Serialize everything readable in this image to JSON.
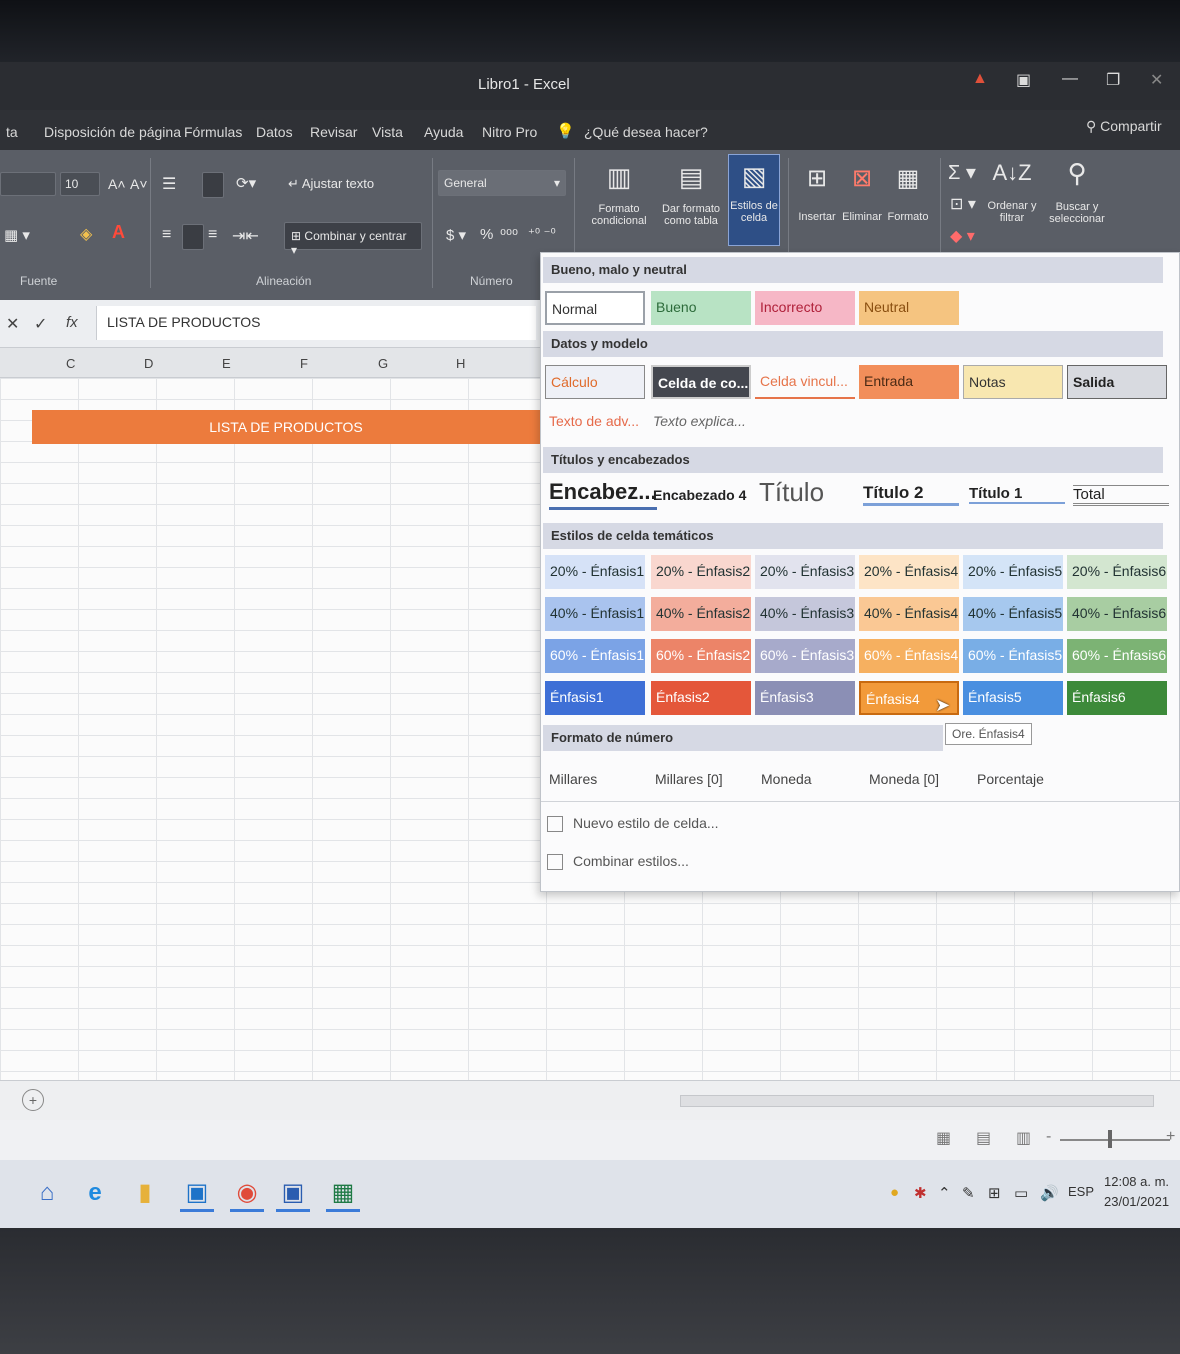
{
  "window": {
    "title": "Libro1 - Excel"
  },
  "tabs": [
    "Disposición de página",
    "Fórmulas",
    "Datos",
    "Revisar",
    "Vista",
    "Ayuda",
    "Nitro Pro"
  ],
  "tell_me": "¿Qué desea hacer?",
  "share": "Compartir",
  "ribbon": {
    "font_size": "10",
    "wrap_text": "Ajustar texto",
    "merge_center": "Combinar y centrar",
    "number_format": "General",
    "currency": "$",
    "percent": "%",
    "conditional_format": "Formato condicional",
    "format_as_table": "Dar formato como tabla",
    "cell_styles": "Estilos de celda",
    "insert": "Insertar",
    "delete": "Eliminar",
    "format": "Formato",
    "sort_filter": "Ordenar y filtrar",
    "find_select": "Buscar y seleccionar",
    "group_font": "Fuente",
    "group_alignment": "Alineación",
    "group_number": "Número"
  },
  "formula_bar": {
    "value": "LISTA DE PRODUCTOS",
    "cancel": "✕",
    "enter": "✓",
    "fx": "fx"
  },
  "columns": [
    "C",
    "D",
    "E",
    "F",
    "G",
    "H"
  ],
  "sheet": {
    "banner": "LISTA DE PRODUCTOS"
  },
  "gallery": {
    "sections": {
      "good_bad": "Bueno, malo y neutral",
      "data_model": "Datos y modelo",
      "titles": "Títulos y encabezados",
      "themed": "Estilos de celda temáticos",
      "number_format": "Formato de número"
    },
    "good_bad": [
      "Normal",
      "Bueno",
      "Incorrecto",
      "Neutral"
    ],
    "data_model_row1": [
      "Cálculo",
      "Celda de co...",
      "Celda vincul...",
      "Entrada",
      "Notas",
      "Salida"
    ],
    "data_model_row2": [
      "Texto de adv...",
      "Texto explica..."
    ],
    "titles": [
      "Encabez...",
      "Encabezado 4",
      "Título",
      "Título 2",
      "Título 1",
      "Total"
    ],
    "themed_20": [
      "20% - Énfasis1",
      "20% - Énfasis2",
      "20% - Énfasis3",
      "20% - Énfasis4",
      "20% - Énfasis5",
      "20% - Énfasis6"
    ],
    "themed_40": [
      "40% - Énfasis1",
      "40% - Énfasis2",
      "40% - Énfasis3",
      "40% - Énfasis4",
      "40% - Énfasis5",
      "40% - Énfasis6"
    ],
    "themed_60": [
      "60% - Énfasis1",
      "60% - Énfasis2",
      "60% - Énfasis3",
      "60% - Énfasis4",
      "60% - Énfasis5",
      "60% - Énfasis6"
    ],
    "themed_100": [
      "Énfasis1",
      "Énfasis2",
      "Énfasis3",
      "Énfasis4",
      "Énfasis5",
      "Énfasis6"
    ],
    "tooltip": "Ore. Énfasis4",
    "number_formats": [
      "Millares",
      "Millares [0]",
      "Moneda",
      "Moneda [0]",
      "Porcentaje"
    ],
    "new_style": "Nuevo estilo de celda...",
    "merge_styles": "Combinar estilos..."
  },
  "taskbar": {
    "language": "ESP",
    "time": "12:08 a. m.",
    "date": "23/01/2021"
  },
  "colors": {
    "accent1": "#3e6fd6",
    "accent2": "#e4573a",
    "accent3": "#8b8fb5",
    "accent4": "#f29a3a",
    "accent5": "#4a8fe0",
    "accent6": "#3d8a3a",
    "banner": "#ec7b3d"
  }
}
